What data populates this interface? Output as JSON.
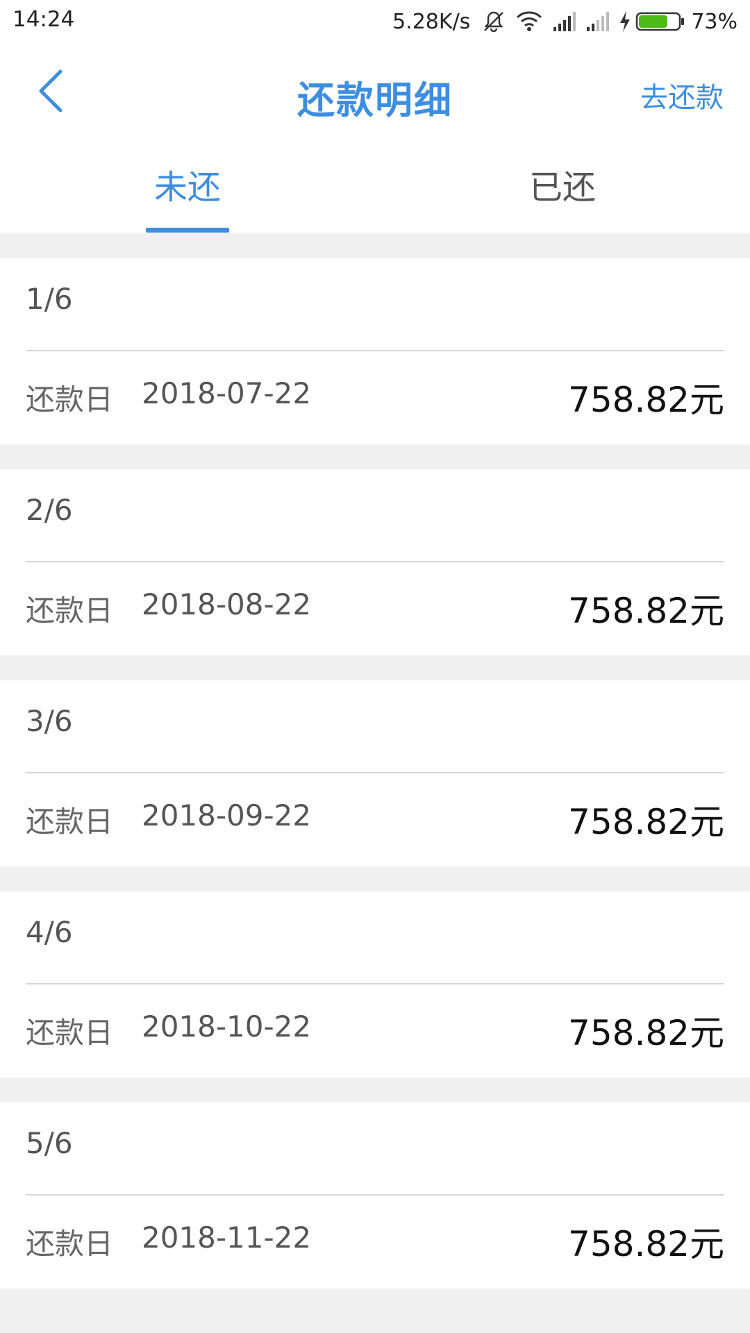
{
  "status_bar": {
    "time": "14:24",
    "network_speed": "5.28K/s",
    "battery_percent": "73%",
    "battery_level": 0.73,
    "icons": [
      "mute-icon",
      "wifi-icon",
      "signal-icon",
      "signal-icon",
      "charging-icon",
      "battery-icon"
    ],
    "battery_color": "#4cbb17"
  },
  "header": {
    "title": "还款明细",
    "action_label": "去还款",
    "accent_color": "#3d8ee0"
  },
  "tabs": [
    {
      "label": "未还",
      "selected": true
    },
    {
      "label": "已还",
      "selected": false
    }
  ],
  "installments": [
    {
      "index": "1/6",
      "date_label": "还款日",
      "date": "2018-07-22",
      "amount": "758.82元"
    },
    {
      "index": "2/6",
      "date_label": "还款日",
      "date": "2018-08-22",
      "amount": "758.82元"
    },
    {
      "index": "3/6",
      "date_label": "还款日",
      "date": "2018-09-22",
      "amount": "758.82元"
    },
    {
      "index": "4/6",
      "date_label": "还款日",
      "date": "2018-10-22",
      "amount": "758.82元"
    },
    {
      "index": "5/6",
      "date_label": "还款日",
      "date": "2018-11-22",
      "amount": "758.82元"
    }
  ]
}
